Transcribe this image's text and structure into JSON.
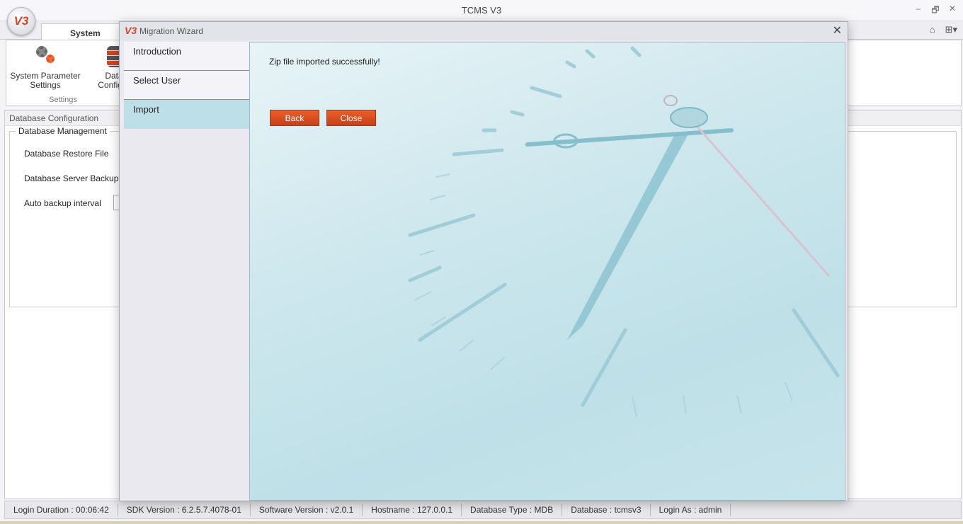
{
  "app": {
    "title": "TCMS V3",
    "logo_text": "V3",
    "window_controls": {
      "minimize": "–",
      "restore": "🗗",
      "close": "✕"
    }
  },
  "ribbon": {
    "tab_label": "System Settings",
    "right_icons": {
      "collapse": "⌂",
      "layout": "⊞▾"
    },
    "buttons": [
      {
        "label": "System Parameter Settings",
        "icon": "gear-icon"
      },
      {
        "label": "Database Configuration",
        "icon": "database-icon"
      }
    ],
    "group_label": "Settings"
  },
  "panel": {
    "header": "Database Configuration",
    "group_title": "Database Management",
    "rows": [
      "Database Restore File",
      "Database Server Backup File",
      "Auto backup interval"
    ]
  },
  "dialog": {
    "logo_text": "V3",
    "title": "Migration Wizard",
    "close": "✕",
    "steps": [
      "Introduction",
      "Select User",
      "Import"
    ],
    "active_step": 2,
    "message": "Zip file imported successfully!",
    "back_label": "Back",
    "close_label": "Close"
  },
  "status_bar": [
    "Login Duration : 00:06:42",
    "SDK Version : 6.2.5.7.4078-01",
    "Software Version : v2.0.1",
    "Hostname : 127.0.0.1",
    "Database Type : MDB",
    "Database : tcmsv3",
    "Login As : admin"
  ],
  "colors": {
    "accent": "#d9432a",
    "button": "#d94e22",
    "active_step": "#bde0e8"
  }
}
